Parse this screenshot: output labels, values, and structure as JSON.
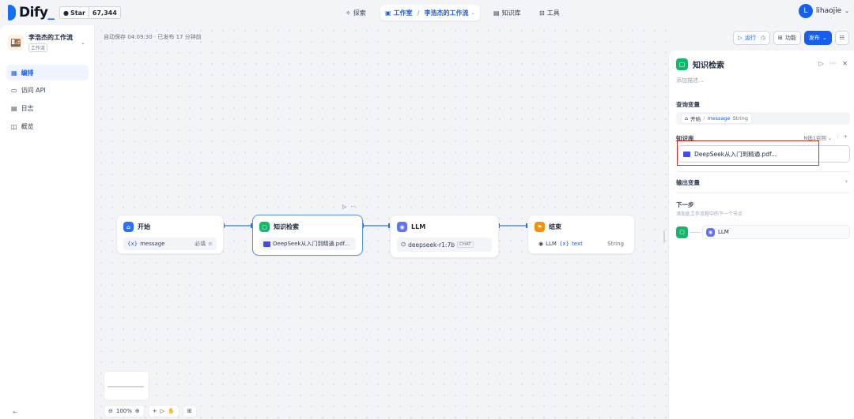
{
  "brand": {
    "name": "Dify",
    "dot": "_"
  },
  "github": {
    "label": "Star",
    "count": "67,344"
  },
  "nav": {
    "explore": "探索",
    "studio": "工作室",
    "sep": "/",
    "app": "李浩杰的工作流",
    "knowledge": "知识库",
    "tools": "工具"
  },
  "user": {
    "initial": "L",
    "name": "lihaojie"
  },
  "sidebar": {
    "app_name": "李浩杰的工作流",
    "app_type": "工作流",
    "items": [
      {
        "label": "编排"
      },
      {
        "label": "访问 API"
      },
      {
        "label": "日志"
      },
      {
        "label": "概览"
      }
    ]
  },
  "canvas": {
    "autosave": "自动保存 04:09:30 · 已发布 17 分钟前",
    "zoom": "100%"
  },
  "actions": {
    "run": "运行",
    "features": "功能",
    "publish": "发布"
  },
  "nodes": {
    "start": {
      "title": "开始",
      "var_prefix": "{x}",
      "var": "message",
      "required": "必填"
    },
    "knowledge": {
      "title": "知识检索",
      "doc": "DeepSeek从入门到精通.pdf..."
    },
    "llm": {
      "title": "LLM",
      "model": "deepseek-r1:7b",
      "mode": "CHAT"
    },
    "end": {
      "title": "结束",
      "src": "LLM",
      "var_prefix": "{x}",
      "var": "text",
      "type": "String"
    }
  },
  "panel": {
    "title": "知识检索",
    "desc": "添加描述...",
    "query_label": "查询变量",
    "query_node": "开始",
    "query_sep": "/",
    "query_var": "message",
    "query_type": "String",
    "kb_label": "知识库",
    "kb_mode": "N选1召回",
    "kb_doc": "DeepSeek从入门到精通.pdf...",
    "output_label": "输出变量",
    "next_label": "下一步",
    "next_sub": "添加此工作流程中的下一个节点",
    "next_node": "LLM"
  },
  "colors": {
    "accent": "#155eef",
    "start": "#2970ff",
    "knowledge": "#12b76a",
    "llm": "#6172f3",
    "end": "#f79009",
    "highlight": "#d92d20"
  }
}
